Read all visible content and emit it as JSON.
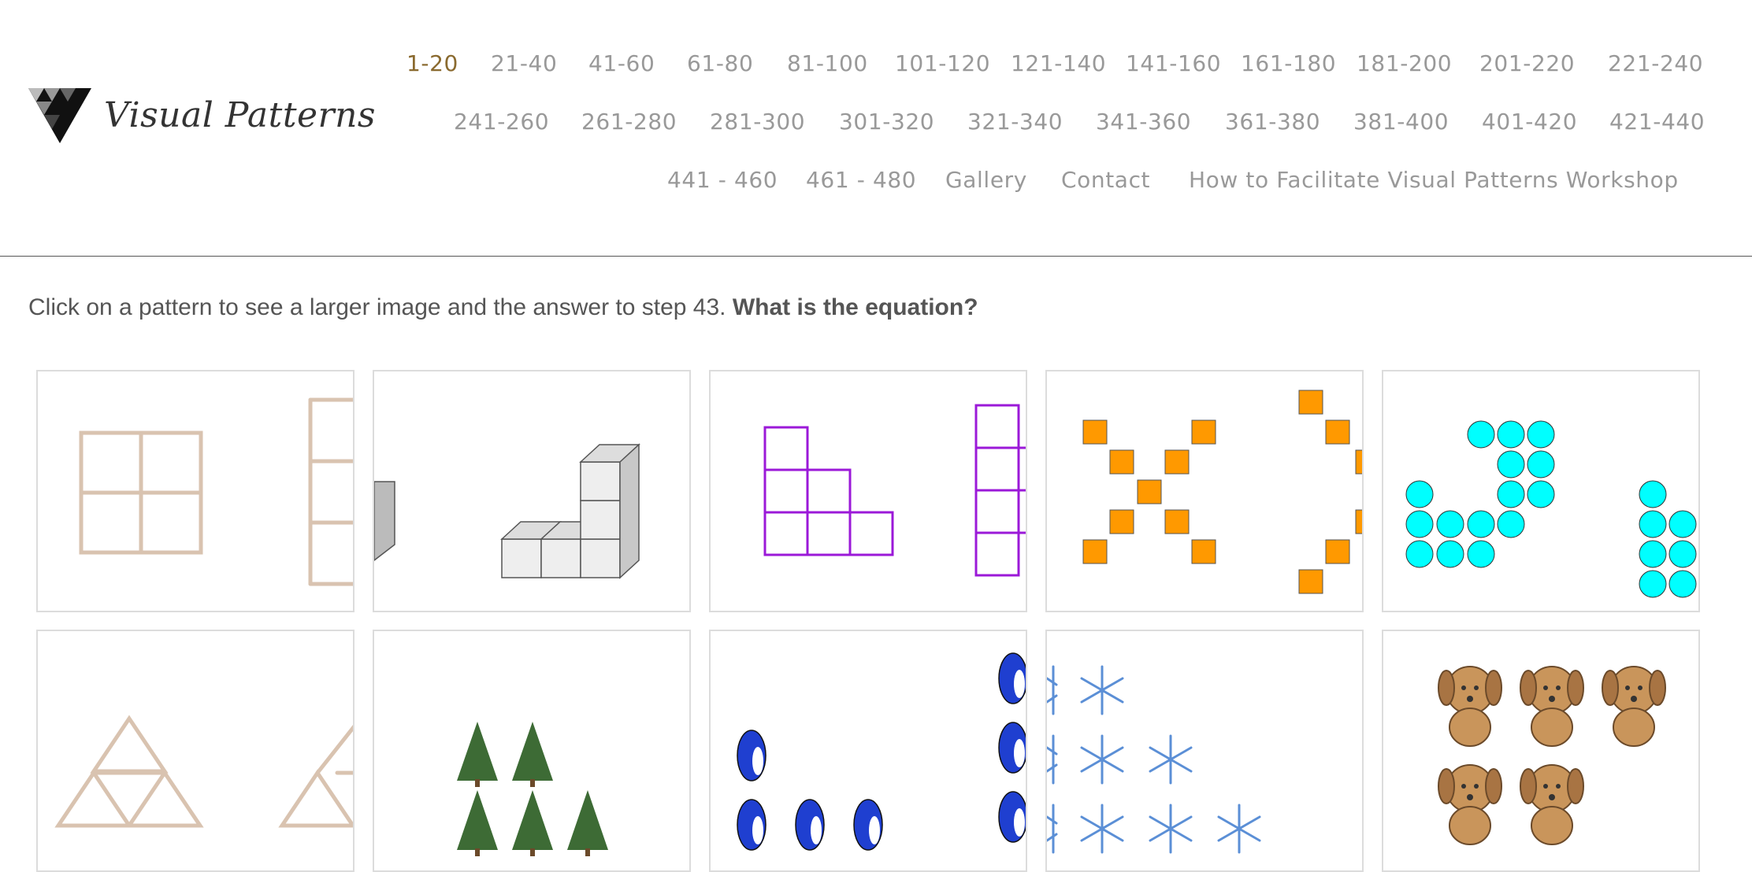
{
  "site": {
    "logo_text": "Visual Patterns"
  },
  "nav": {
    "row1": [
      "1-20",
      "21-40",
      "41-60",
      "61-80",
      "81-100",
      "101-120",
      "121-140",
      "141-160",
      "161-180",
      "181-200",
      "201-220",
      "221-240"
    ],
    "row2": [
      "241-260",
      "261-280",
      "281-300",
      "301-320",
      "321-340",
      "341-360",
      "361-380",
      "381-400",
      "401-420",
      "421-440"
    ],
    "row3": [
      "441 - 460",
      "461 - 480",
      "Gallery",
      "Contact",
      "How to Facilitate Visual Patterns Workshop"
    ],
    "active": "1-20"
  },
  "intro": {
    "text": "Click on a pattern to see a larger image and the answer to step 43.",
    "question": "What is the equation?"
  },
  "colors": {
    "accent": "#8a6a2f",
    "nav": "#999999",
    "matchstick": "#d9c3b0",
    "purple": "#9b19d8",
    "orange": "#ff9900",
    "cyan": "#00ffff"
  },
  "patterns": [
    {
      "icon": "matchstick-grid-icon"
    },
    {
      "icon": "cube-stack-icon"
    },
    {
      "icon": "purple-squares-icon"
    },
    {
      "icon": "orange-x-squares-icon"
    },
    {
      "icon": "cyan-dots-icon"
    },
    {
      "icon": "matchstick-triangles-icon"
    },
    {
      "icon": "pine-trees-icon"
    },
    {
      "icon": "penguins-icon"
    },
    {
      "icon": "snowflakes-icon"
    },
    {
      "icon": "puppies-icon"
    }
  ]
}
